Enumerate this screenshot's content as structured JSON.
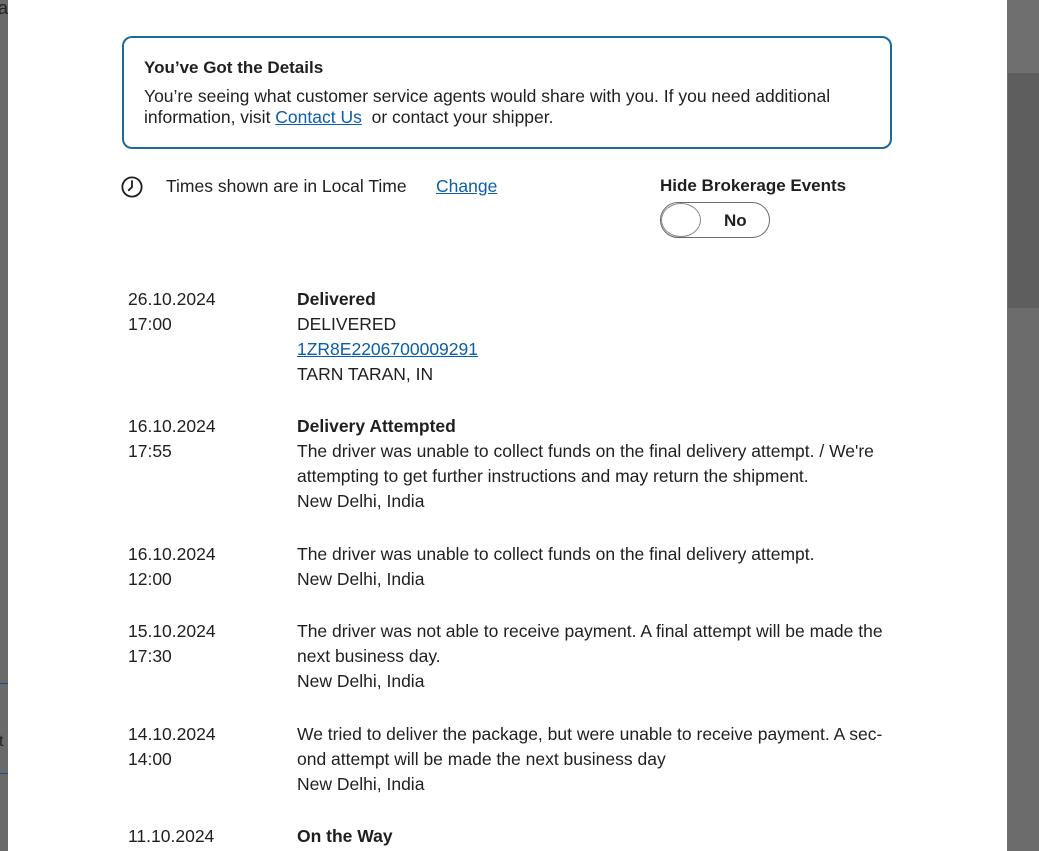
{
  "background": {
    "left_text_top": "a",
    "left_text_bottom": "t"
  },
  "notice": {
    "title": "You’ve Got the Details",
    "body_before": "You’re seeing what customer service agents would share with you. If you need additional information, visit ",
    "link": "Contact Us",
    "body_after": "  or contact your shipper."
  },
  "timezone": {
    "label": "Times shown are in Local Time",
    "change": "Change"
  },
  "brokerage_toggle": {
    "label": "Hide Brokerage Events",
    "value": "No"
  },
  "events": [
    {
      "date": "26.10.2024",
      "time": "17:00",
      "status": "Delivered",
      "lines": [
        "DELIVERED"
      ],
      "tracking": "1ZR8E2206700009291",
      "location": "TARN TARAN, IN"
    },
    {
      "date": "16.10.2024",
      "time": "17:55",
      "status": "Delivery Attempted",
      "lines": [
        "The driver was unable to collect funds on the final delivery attempt. / We're attempting to get further instructions and may return the shipment."
      ],
      "location": "New Delhi, India"
    },
    {
      "date": "16.10.2024",
      "time": "12:00",
      "lines": [
        "The driver was unable to collect funds on the final delivery attempt."
      ],
      "location": "New Delhi, India"
    },
    {
      "date": "15.10.2024",
      "time": "17:30",
      "lines": [
        "The driver was not able to receive payment. A final attempt will be made the next business day."
      ],
      "location": "New Delhi, India"
    },
    {
      "date": "14.10.2024",
      "time": "14:00",
      "lines": [
        "We tried to deliver the package, but were unable to receive payment. A sec-ond attempt will be made the next business day"
      ],
      "location": "New Delhi, India"
    },
    {
      "date": "11.10.2024",
      "time": "",
      "status": "On the Way",
      "lines": [],
      "location": ""
    }
  ],
  "colors": {
    "accent": "#1b6a9a",
    "link": "#0a5eaa",
    "overlay": "#6e6e6e"
  }
}
